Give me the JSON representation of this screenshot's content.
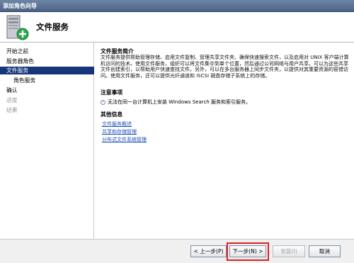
{
  "window": {
    "title": "添加角色向导"
  },
  "header": {
    "title": "文件服务",
    "icon": "server-role-add-icon"
  },
  "nav": {
    "items": [
      {
        "label": "开始之前",
        "state": "normal"
      },
      {
        "label": "服务器角色",
        "state": "normal"
      },
      {
        "label": "文件服务",
        "state": "active"
      },
      {
        "label": "角色服务",
        "state": "sub"
      },
      {
        "label": "确认",
        "state": "normal"
      },
      {
        "label": "进度",
        "state": "disabled"
      },
      {
        "label": "结果",
        "state": "disabled"
      }
    ]
  },
  "content": {
    "intro_title": "文件服务简介",
    "intro_text": "文件服务提供帮助管理存储、启用文件复制、管理共享文件夹、确保快速搜索文件，以及启用对 UNIX 客户端计算机访问的技术。使用文件服务，组织可以将文件集中到单个位置，然后通过公司网络与用户共享。可以为这些共享文件创建索引，以帮助用户快速查找文件。另外，可以在多台服务器上同步文件夹，以提供对其重要资源的容错访问。使用文件服务，还可以提供光纤通道和 iSCSI 磁盘存储子系统上的存储。",
    "notes_title": "注意事项",
    "note_text": "无法在同一台计算机上安装 Windows Search 服务和索引服务。",
    "more_title": "其他信息",
    "links": [
      "文件服务概述",
      "共享和存储管理",
      "分布式文件系统管理"
    ]
  },
  "buttons": {
    "prev": "< 上一步(P)",
    "next": "下一步(N) >",
    "install": "安装(I)",
    "cancel": "取消"
  },
  "colors": {
    "accent": "#16367c",
    "highlight": "#e02020",
    "link": "#1d4fb7"
  }
}
